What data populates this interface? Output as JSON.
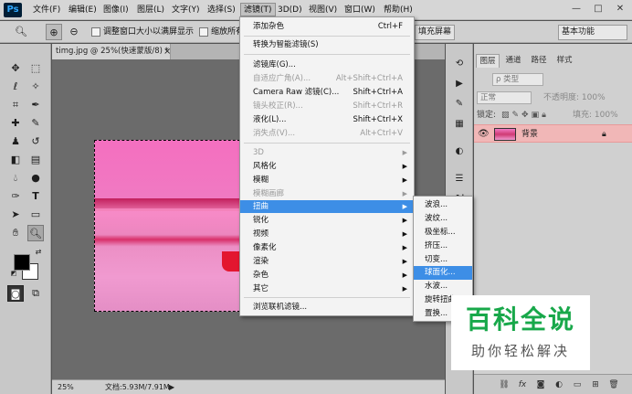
{
  "app": {
    "logo": "Ps"
  },
  "menubar": {
    "items": [
      "文件(F)",
      "编辑(E)",
      "图像(I)",
      "图层(L)",
      "文字(Y)",
      "选择(S)",
      "滤镜(T)",
      "3D(D)",
      "视图(V)",
      "窗口(W)",
      "帮助(H)"
    ],
    "window_buttons": [
      "—",
      "□",
      "✕"
    ]
  },
  "options": {
    "checkbox1_label": "调整窗口大小以满屏显示",
    "checkbox2_label": "缩放所有",
    "fill_screen": "填充屏幕",
    "workspace": "基本功能"
  },
  "document": {
    "tab_title": "timg.jpg @ 25%(快速蒙版/8) *",
    "close_glyph": "×",
    "zoom": "25%",
    "doc_size": "文档:5.93M/7.91M"
  },
  "layers_panel": {
    "tabs": [
      "图层",
      "通道",
      "路径",
      "样式"
    ],
    "filter_label": "ρ 类型",
    "blend_mode": "正常",
    "opacity_label": "不透明度: 100%",
    "lock_label": "锁定:",
    "fill_label": "填充: 100%",
    "layer_name": "背景"
  },
  "filter_menu": {
    "items": [
      {
        "label": "添加杂色",
        "shortcut": "Ctrl+F"
      },
      {
        "label": "转换为智能滤镜(S)"
      },
      {
        "label": "滤镜库(G)..."
      },
      {
        "label": "自适应广角(A)...",
        "shortcut": "Alt+Shift+Ctrl+A"
      },
      {
        "label": "Camera Raw 滤镜(C)...",
        "shortcut": "Shift+Ctrl+A"
      },
      {
        "label": "镜头校正(R)...",
        "shortcut": "Shift+Ctrl+R"
      },
      {
        "label": "液化(L)...",
        "shortcut": "Shift+Ctrl+X"
      },
      {
        "label": "消失点(V)...",
        "shortcut": "Alt+Ctrl+V"
      },
      {
        "label": "3D"
      },
      {
        "label": "风格化"
      },
      {
        "label": "模糊"
      },
      {
        "label": "模糊画廊"
      },
      {
        "label": "扭曲"
      },
      {
        "label": "锐化"
      },
      {
        "label": "视频"
      },
      {
        "label": "像素化"
      },
      {
        "label": "渲染"
      },
      {
        "label": "杂色"
      },
      {
        "label": "其它"
      },
      {
        "label": "浏览联机滤镜..."
      }
    ],
    "arrow": "▶"
  },
  "distort_submenu": {
    "items": [
      "波浪...",
      "波纹...",
      "极坐标...",
      "挤压...",
      "切变...",
      "球面化...",
      "水波...",
      "旋转扭曲...",
      "置换..."
    ]
  },
  "watermark": {
    "title": "百科全说",
    "subtitle": "助你轻松解决"
  },
  "colors": {
    "accent": "#3d8ee6",
    "layer_selected": "#f1b7b7",
    "watermark_green": "#18a84a"
  }
}
